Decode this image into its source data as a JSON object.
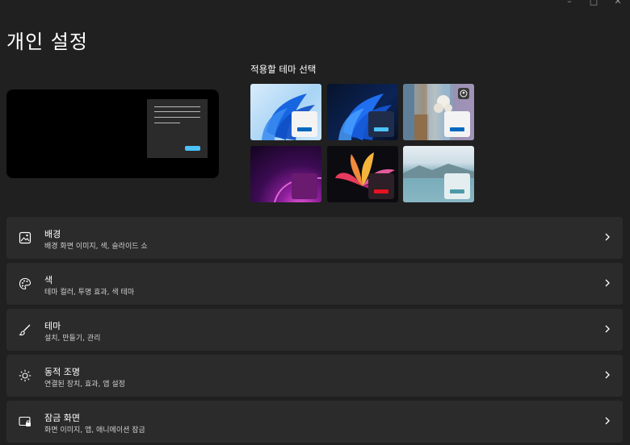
{
  "window_controls": {
    "minimize": "–",
    "maximize": "□",
    "close": "✕"
  },
  "page_title": "개인 설정",
  "themes_heading": "적용할 테마 선택",
  "themes": [
    {
      "id": "windows-light",
      "icon": "theme-light"
    },
    {
      "id": "windows-dark",
      "icon": "theme-dark"
    },
    {
      "id": "glow-spotlight",
      "icon": "theme-spotlight"
    },
    {
      "id": "purple-glow",
      "icon": "theme-purple"
    },
    {
      "id": "captured-motion",
      "icon": "theme-flower"
    },
    {
      "id": "sunrise-lake",
      "icon": "theme-lake"
    }
  ],
  "settings": [
    {
      "title": "배경",
      "desc": "배경 화면 이미지, 색, 슬라이드 쇼",
      "icon": "image-icon"
    },
    {
      "title": "색",
      "desc": "테마 컬러, 투명 효과, 색 테마",
      "icon": "palette-icon"
    },
    {
      "title": "테마",
      "desc": "설치, 만들기, 관리",
      "icon": "brush-icon"
    },
    {
      "title": "동적 조명",
      "desc": "연결된 장치, 효과, 앱 설정",
      "icon": "dynamic-lighting-icon"
    },
    {
      "title": "잠금 화면",
      "desc": "화면 이미지, 앱, 애니메이션 잠금",
      "icon": "lock-screen-icon"
    }
  ],
  "colors": {
    "background": "#202020",
    "card": "#2b2b2b",
    "accent": "#4cc2ff"
  }
}
